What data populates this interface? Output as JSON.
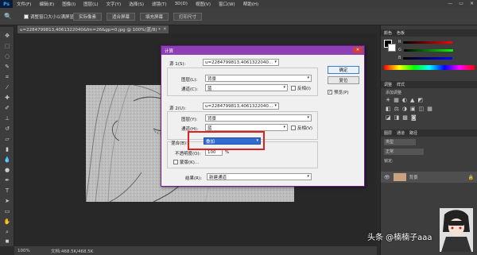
{
  "app": {
    "logo": "Ps"
  },
  "menubar": {
    "items": [
      "文件(F)",
      "编辑(E)",
      "图像(I)",
      "图层(L)",
      "文字(Y)",
      "选择(S)",
      "滤镜(T)",
      "3D(D)",
      "视图(V)",
      "窗口(W)",
      "帮助(H)"
    ],
    "minimize": "—",
    "restore": "▭",
    "close": "✕"
  },
  "options": {
    "resize_windows_label": "调整窗口大小以满屏显示",
    "actual_pixels": "实际像素",
    "fit_screen": "适合屏幕",
    "fill_screen": "填充屏幕",
    "print_size": "打印尺寸"
  },
  "document": {
    "tab_title": "u=2284799813,4061322040&fm=26&gp=0.jpg @ 100%(蓝/8) *",
    "zoom": "100%",
    "doc_info": "文档:468.5K/468.5K"
  },
  "panels": {
    "color_tab": "颜色",
    "swatches_tab": "色板",
    "color_r": "R",
    "color_g": "G",
    "color_b": "B",
    "adjust_tab": "调整",
    "styles_tab": "样式",
    "add_adjustment": "添加调整",
    "layers_tab": "图层",
    "channels_tab": "通道",
    "paths_tab": "路径",
    "kind_label": "类型",
    "normal": "正常",
    "lock_label": "锁定:",
    "layer_name": "背景"
  },
  "dialog": {
    "title": "计算",
    "source1": {
      "label": "源 1(S):",
      "source_value": "u=2284799813,4061322040...",
      "layer_label": "图层(L):",
      "layer_value": "背景",
      "channel_label": "通道(C):",
      "channel_value": "蓝",
      "invert_label": "反相(I)"
    },
    "source2": {
      "label": "源 2(U):",
      "source_value": "u=2284799813,4061322040...",
      "layer_label": "图层(Y):",
      "layer_value": "背景",
      "channel_label": "通道(H):",
      "channel_value": "蓝",
      "invert_label": "反相(V)"
    },
    "blending": {
      "label": "混合(B):",
      "value": "叠加",
      "opacity_label": "不透明度(O):",
      "opacity_value": "100",
      "percent": "%",
      "mask_label": "蒙版(K)..."
    },
    "result": {
      "label": "结果(R):",
      "value": "新建通道"
    },
    "ok": "确定",
    "reset": "复位",
    "preview_label": "预览(P)",
    "preview_checked": true
  },
  "watermark": "头条 @楠楠子aaa",
  "colors": {
    "dialog_title": "#8d3fb3",
    "highlight": "#e02020",
    "selected": "#2f6bd1"
  }
}
